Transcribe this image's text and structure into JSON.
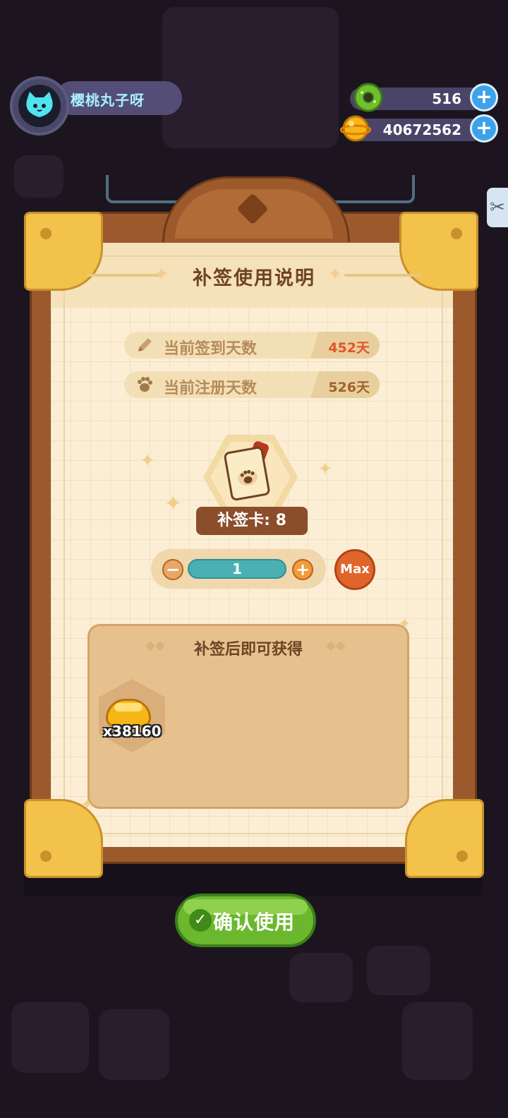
{
  "player": {
    "name": "樱桃丸子呀",
    "avatar_icon": "cat-face-icon"
  },
  "currencies": [
    {
      "icon": "donut-icon",
      "value": "516",
      "color": "#7ac943"
    },
    {
      "icon": "gold-coin-icon",
      "value": "40672562",
      "color": "#f7b617"
    }
  ],
  "dialog": {
    "title": "补签使用说明",
    "info_rows": [
      {
        "icon": "pencil-icon",
        "label": "当前签到天数",
        "value": "452天",
        "value_color": "#e0552a"
      },
      {
        "icon": "paw-icon",
        "label": "当前注册天数",
        "value": "526天",
        "value_color": "#a0622e"
      }
    ],
    "card": {
      "icon": "makeup-card-icon",
      "label": "补签卡: 8"
    },
    "stepper": {
      "minus": "−",
      "value": "1",
      "plus": "+",
      "max_label": "Max"
    },
    "reward": {
      "title": "补签后即可获得",
      "items": [
        {
          "icon": "gold-coin-pile-icon",
          "qty": "x38160"
        }
      ]
    },
    "confirm_label": "确认使用"
  }
}
